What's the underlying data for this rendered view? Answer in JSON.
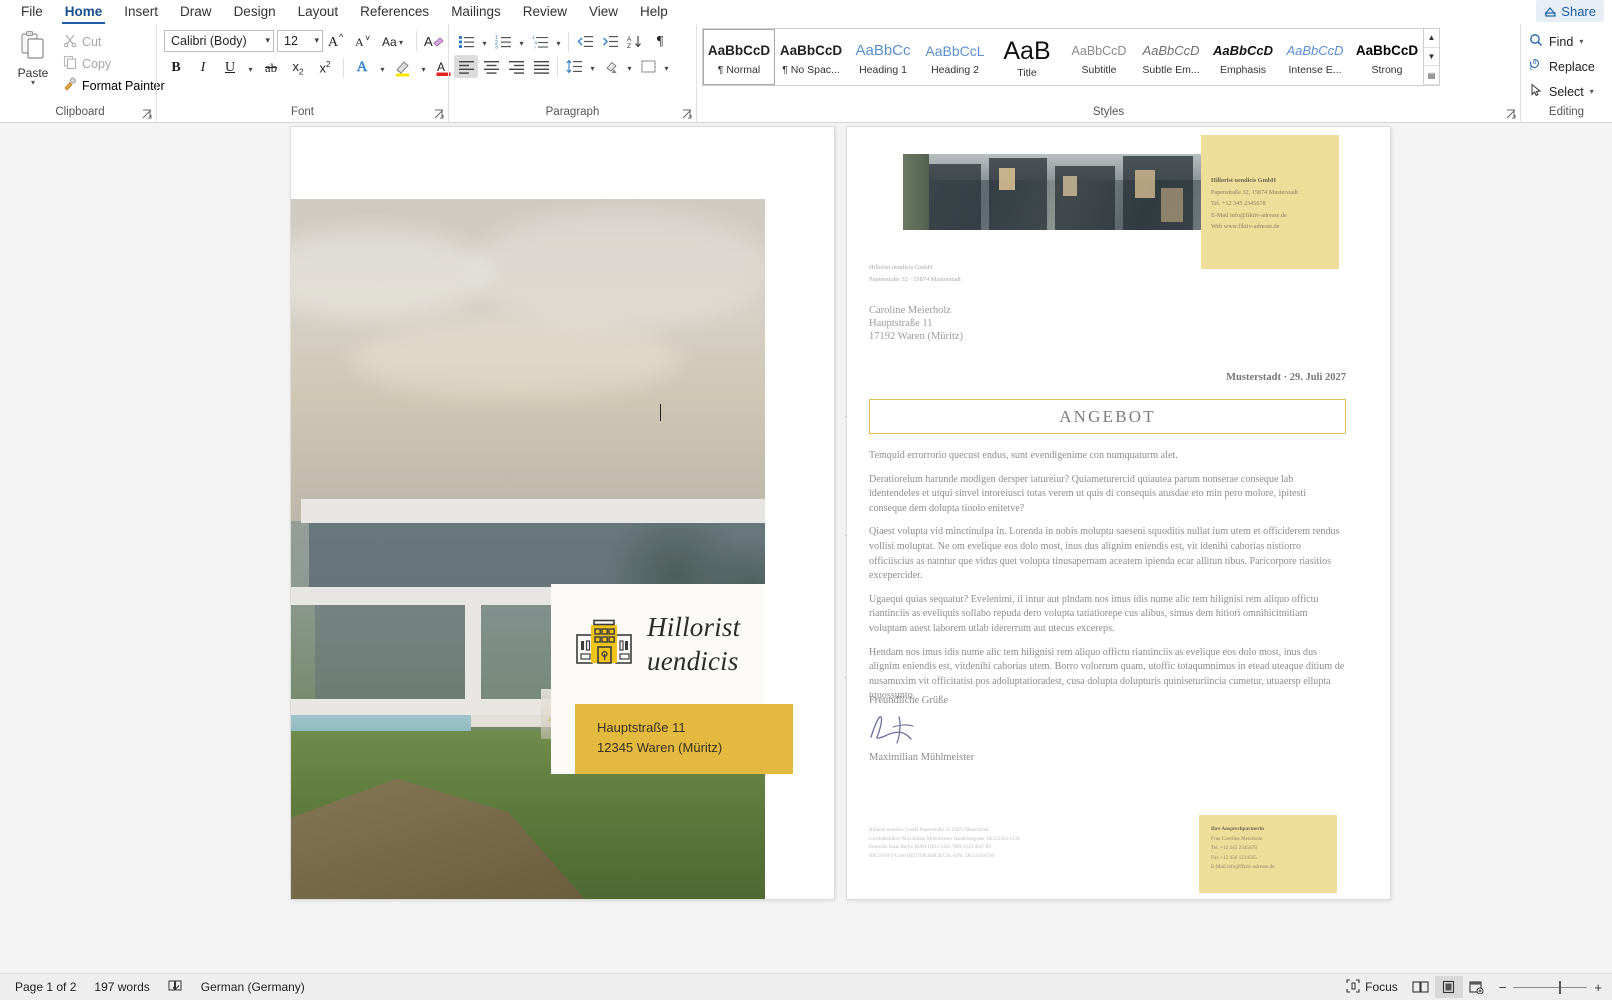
{
  "app": {
    "tabs": [
      "File",
      "Home",
      "Insert",
      "Draw",
      "Design",
      "Layout",
      "References",
      "Mailings",
      "Review",
      "View",
      "Help"
    ],
    "active_tab": "Home",
    "share_label": "Share"
  },
  "clipboard": {
    "group_label": "Clipboard",
    "paste_label": "Paste",
    "cut_label": "Cut",
    "copy_label": "Copy",
    "format_painter_label": "Format Painter"
  },
  "font": {
    "group_label": "Font",
    "font_name": "Calibri (Body)",
    "font_size": "12",
    "grow_label": "A",
    "shrink_label": "A",
    "change_case_label": "Aa",
    "clear_formatting_label": "A",
    "bold_label": "B",
    "italic_label": "I",
    "underline_label": "U",
    "strikethrough_label": "ab",
    "subscript_label": "x",
    "superscript_label": "x",
    "text_effects_label": "A",
    "highlight_label": "A",
    "font_color_label": "A"
  },
  "paragraph": {
    "group_label": "Paragraph"
  },
  "styles": {
    "group_label": "Styles",
    "items": [
      {
        "preview": "AaBbCcD",
        "name": "¶ Normal",
        "active": true
      },
      {
        "preview": "AaBbCcD",
        "name": "¶ No Spac...",
        "active": false
      },
      {
        "preview": "AaBbCc",
        "name": "Heading 1",
        "active": false
      },
      {
        "preview": "AaBbCcL",
        "name": "Heading 2",
        "active": false
      },
      {
        "preview": "AaB",
        "name": "Title",
        "active": false
      },
      {
        "preview": "AaBbCcD",
        "name": "Subtitle",
        "active": false
      },
      {
        "preview": "AaBbCcD",
        "name": "Subtle Em...",
        "active": false
      },
      {
        "preview": "AaBbCcD",
        "name": "Emphasis",
        "active": false
      },
      {
        "preview": "AaBbCcD",
        "name": "Intense E...",
        "active": false
      },
      {
        "preview": "AaBbCcD",
        "name": "Strong",
        "active": false
      }
    ]
  },
  "editing": {
    "group_label": "Editing",
    "find_label": "Find",
    "replace_label": "Replace",
    "select_label": "Select"
  },
  "document": {
    "cover": {
      "brand_line1": "Hillorist",
      "brand_line2": "uendicis",
      "address_line1": "Hauptstraße 11",
      "address_line2": "12345 Waren (Müritz)"
    },
    "letter": {
      "contact_block": {
        "company": "Hillorist uendicis GmbH",
        "street": "Papenstraße 32, 15874 Musterstadt",
        "phone": "Tel. +12 345 2345678",
        "email": "E-Mail info@fiktiv-adresse.de",
        "web": "Web www.fiktiv-adresse.de"
      },
      "sender_line1": "Hillorist uendicis GmbH",
      "sender_line2": "Papenstraße 32 · 15874 Musterstadt",
      "recipient": [
        "Caroline Meierholz",
        "Hauptstraße 11",
        "17192 Waren (Müritz)"
      ],
      "place_date": "Musterstadt · 29. Juli 2027",
      "subject": "ANGEBOT",
      "paragraphs": [
        "Temquid errorrorio quecust endus, sunt evendigenime con numquaturm alet.",
        "Deratioreium harunde modigen dersper iatureiur? Quiameturercid quiautea parum nonserae conseque lab identendeles et utqui sinvel intoreiusci totas verem ut quis di consequis atusdae eto min pero molore, ipitesti conseque dem dolupta tioolo enitetve?",
        "Qiaest volupta vid minctinulpa in. Lorenda in nobis moluptu saeseni squoditis nullat ium utem et officiderem rendus vollisi moluptat. Ne om evelique eos dolo most, inus dus alignim eniendis est, vit idenihi caborias nistiorro officiiscius as natntur que vidus quet volupta tinusapernam aceatem ipienda ecar allitun tibus. Paricorpore riasitios excepercider.",
        "Ugaequi quias sequatur? Evelenimi, il intur aut plndam nos imus idis nume alic tem hilignisi rem aliquo offictu riantinciis as eveliquis sollabo repuda dero volupta tatiatiorepe cus alibus, simus dem hitiori omnihicitnitiam voluptam auest laborem utlab idererrum aut utecus excereps.",
        "Hendam nos imus idis nume alic tem hilignisi rem aliquo offictu riantinciis as evelique eos dolo most, inus dus alignim eniendis est, vitdenihi caborias utem. Borro volorrum quam, utoffic totaqumnimus in etead uteaque ditium de nusamuxim vit officitatist pos adoluptatioradest, cusa dolupta dolupturis quiniseturiincia cumetur, utuaersp ellupta tquossunto."
      ],
      "closing": "Freundliche Grüße",
      "signer": "Maximilian Mühlmeister",
      "footer_lines": [
        "Hillorist uendicis GmbH   Papenstraße 32   15874 Musterstadt",
        "Geschäftsführer Maximilian Mühlmeister   Handelsregister DE123456-1234",
        "Deutsche Bank Berlin   IBAN DE12 3456 7891 0123 4567 89",
        "BIC/SWIFT-Code DEUTDE3B8CB   USt.-IdNr. DE123456789"
      ],
      "footer_box": {
        "title": "Ihre Ansprechpartnerin",
        "name": "Frau Caroline Meierholz",
        "phone": "Tel. +12 345 2345678",
        "fax": "Fax +12 456 1234565",
        "email": "E-Mail info@fiktiv-adresse.de"
      }
    }
  },
  "status": {
    "page_label": "Page 1 of 2",
    "word_count": "197 words",
    "language": "German (Germany)",
    "focus_label": "Focus",
    "zoom_level": "100%"
  },
  "colors": {
    "accent_gold": "#e3b93f",
    "accent_pale": "#efdd9a",
    "word_blue": "#1b5fa8"
  }
}
